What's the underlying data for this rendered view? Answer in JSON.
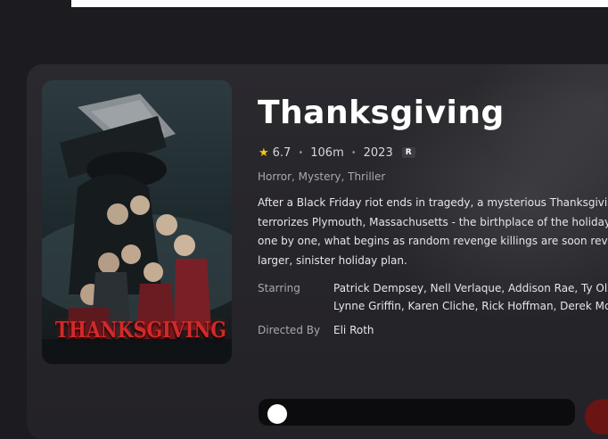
{
  "movie": {
    "title": "Thanksgiving",
    "rating": "6.7",
    "runtime": "106m",
    "year": "2023",
    "certification": "R",
    "genres": "Horror, Mystery, Thriller",
    "overview_lines": [
      "After a Black Friday riot ends in tragedy, a mysterious Thanksgiving",
      "terrorizes Plymouth, Massachusetts - the birthplace of the holiday",
      "one by one, what begins as random revenge killings are soon revea",
      "larger, sinister holiday plan."
    ],
    "poster_title": "THANKSGIVING"
  },
  "credits": {
    "starring_label": "Starring",
    "starring_lines": [
      "Patrick Dempsey, Nell Verlaque, Addison Rae, Ty Olss",
      "Lynne Griffin, Karen Cliche, Rick Hoffman, Derek McG"
    ],
    "directed_label": "Directed By",
    "director": "Eli Roth"
  },
  "icons": {
    "star": "star-icon",
    "play": "play-icon"
  },
  "colors": {
    "background": "#1c1b20",
    "card": "#2a292e",
    "star": "#f5c518",
    "poster_title": "#d12a2a"
  }
}
